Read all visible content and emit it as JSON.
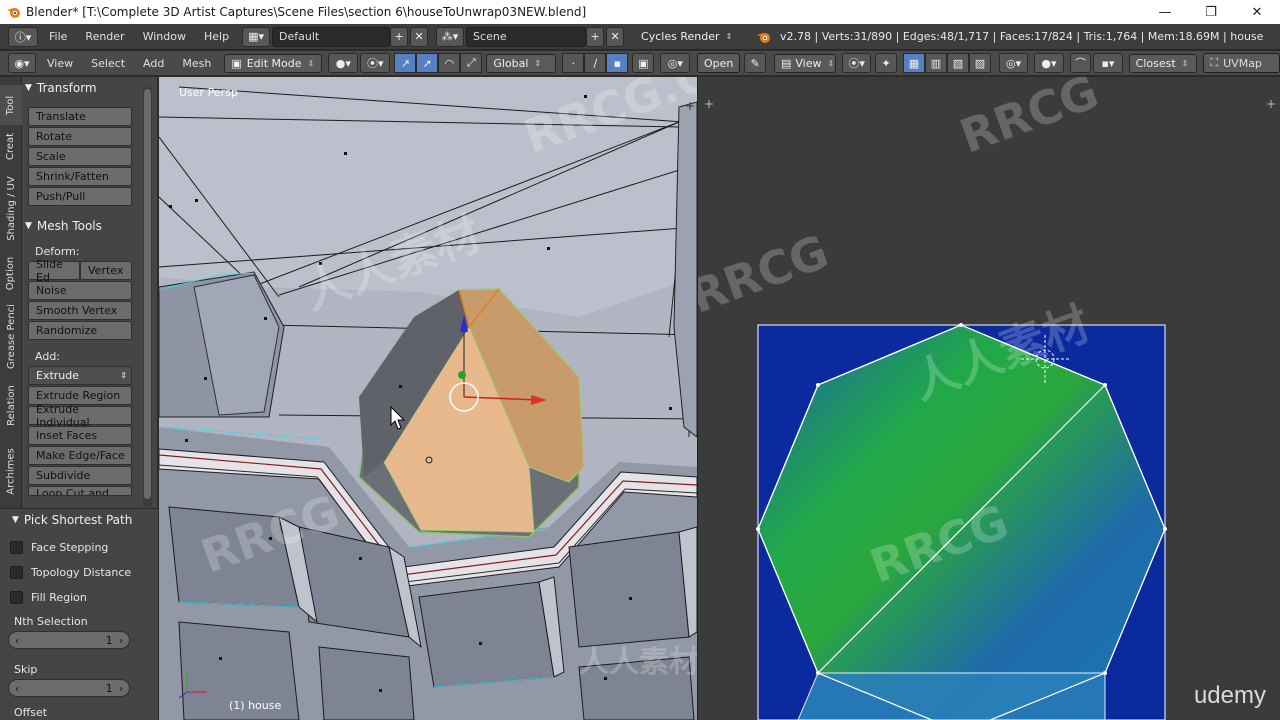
{
  "window": {
    "title": "Blender* [T:\\Complete 3D Artist Captures\\Scene Files\\section 6\\houseToUnwrap03NEW.blend]",
    "minimize": "—",
    "maximize": "❐",
    "close": "✕"
  },
  "info_header": {
    "menus": [
      "File",
      "Render",
      "Window",
      "Help"
    ],
    "layout": "Default",
    "scene": "Scene",
    "engine": "Cycles Render",
    "stats": "v2.78 | Verts:31/890 | Edges:48/1,717 | Faces:17/824 | Tris:1,764 | Mem:18.69M | house"
  },
  "view_header": {
    "menus": [
      "View",
      "Select",
      "Add",
      "Mesh"
    ],
    "mode": "Edit Mode",
    "orientation": "Global"
  },
  "uv_header": {
    "open": "Open",
    "view": "View",
    "snap": "Closest",
    "uvmap": "UVMap"
  },
  "toolshelf": {
    "tabs": [
      "Tool",
      "Creat",
      "Shading / UV",
      "Option",
      "Grease Penci",
      "Relation",
      "Archimes"
    ],
    "transform_title": "Transform",
    "transform": [
      "Translate",
      "Rotate",
      "Scale",
      "Shrink/Fatten",
      "Push/Pull"
    ],
    "mesh_tools_title": "Mesh Tools",
    "deform_label": "Deform:",
    "slide_edge": "Slide Ed",
    "vertex": "Vertex",
    "deform": [
      "Noise",
      "Smooth Vertex",
      "Randomize"
    ],
    "add_label": "Add:",
    "extrude": "Extrude",
    "add": [
      "Extrude Region",
      "Extrude Individual",
      "Inset Faces",
      "Make Edge/Face",
      "Subdivide",
      "Loop Cut and Slide"
    ]
  },
  "operator_panel": {
    "title": "Pick Shortest Path",
    "options": [
      "Face Stepping",
      "Topology Distance",
      "Fill Region"
    ],
    "nth_label": "Nth Selection",
    "nth_value": "1",
    "skip_label": "Skip",
    "skip_value": "1",
    "offset_label": "Offset"
  },
  "viewport": {
    "persp_label": "User Persp",
    "object_label": "(1) house"
  },
  "watermarks": [
    "RRCG.CN",
    "人人素材",
    "RRCG",
    "人人素材"
  ],
  "udemy": "udemy",
  "colors": {
    "selected_face": "#e8a865",
    "uv_blue": "#0a2aa0",
    "uv_green": "#29b82d",
    "viewport_bg": "#b4b8c5"
  }
}
